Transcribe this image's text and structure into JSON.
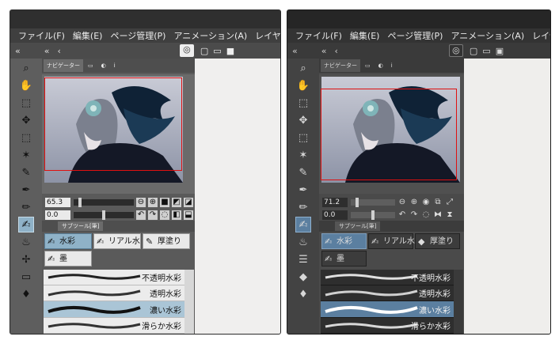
{
  "menu": [
    "ファイル(F)",
    "編集(E)",
    "ページ管理(P)",
    "アニメーション(A)",
    "レイヤー(L)"
  ],
  "navigator_tab": "ナビゲーター",
  "subtool_tab": "サブツール[筆]",
  "left": {
    "zoom": "65.3",
    "rotation": "0.0",
    "groups": [
      "水彩",
      "リアル水",
      "厚塗り",
      "墨"
    ],
    "brushes": [
      "不透明水彩",
      "透明水彩",
      "濃い水彩",
      "滑らか水彩"
    ]
  },
  "right": {
    "zoom": "71.2",
    "rotation": "0.0",
    "groups": [
      "水彩",
      "リアル水",
      "厚塗り",
      "墨"
    ],
    "brushes": [
      "不透明水彩",
      "透明水彩",
      "濃い水彩",
      "滑らか水彩"
    ]
  }
}
